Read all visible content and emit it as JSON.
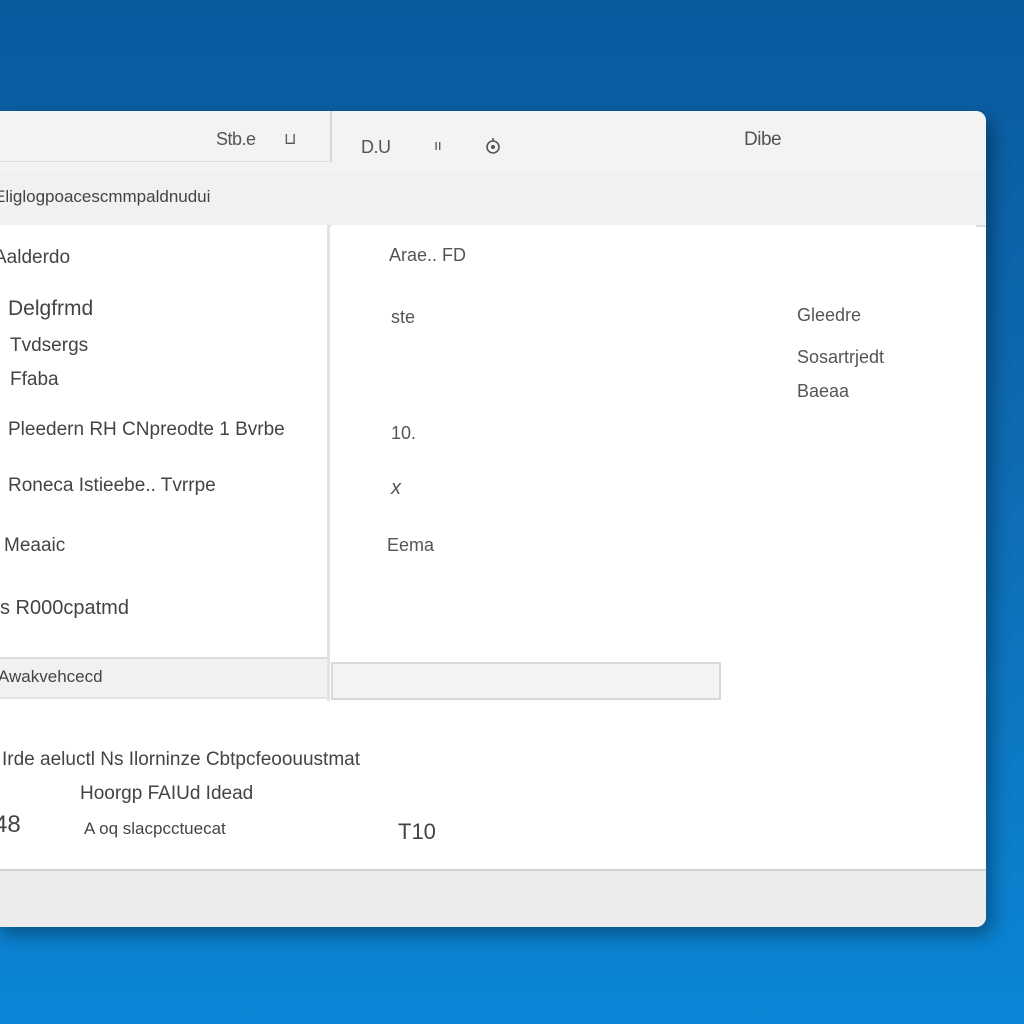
{
  "titlebar": {
    "left_label": "Stb.e",
    "left_icon_label": "⊔",
    "middle_label": "D.U",
    "middle_icon_label": "ıı",
    "title": "Dibe"
  },
  "address": {
    "text": "Eliglogpoacescmmpaldnudui"
  },
  "sidebar": {
    "header": "Aalderdo",
    "items": [
      {
        "label": "Delgfrmd"
      },
      {
        "label": "Tvdsergs"
      },
      {
        "label": "Ffaba"
      },
      {
        "label": "Pleedern RH CNpreodte 1 Bvrbe"
      },
      {
        "label": "Roneca Istieebe.. Tvrrpe"
      },
      {
        "label": "Meaaic"
      },
      {
        "label": "s R000cpatmd"
      }
    ],
    "footer": "Awakvehcecd"
  },
  "content": {
    "header": "Arae.. FD",
    "rows": [
      {
        "label": "ste"
      },
      {
        "label": "10."
      },
      {
        "label": "x"
      },
      {
        "label": "Eema"
      }
    ],
    "right_labels": [
      {
        "label": "Gleedre"
      },
      {
        "label": "Sosartrjedt"
      },
      {
        "label": "Baeaa"
      }
    ]
  },
  "bottom": {
    "line1": "Irde aeluctl Ns Ilorninze Cbtpcfeoouustmat",
    "line2": "Hoorgp FAIUd Idead",
    "left_value": "48",
    "line3": "A oq slacpcctuecat",
    "value": "T10"
  },
  "icons": {
    "settings": "gear-icon"
  }
}
